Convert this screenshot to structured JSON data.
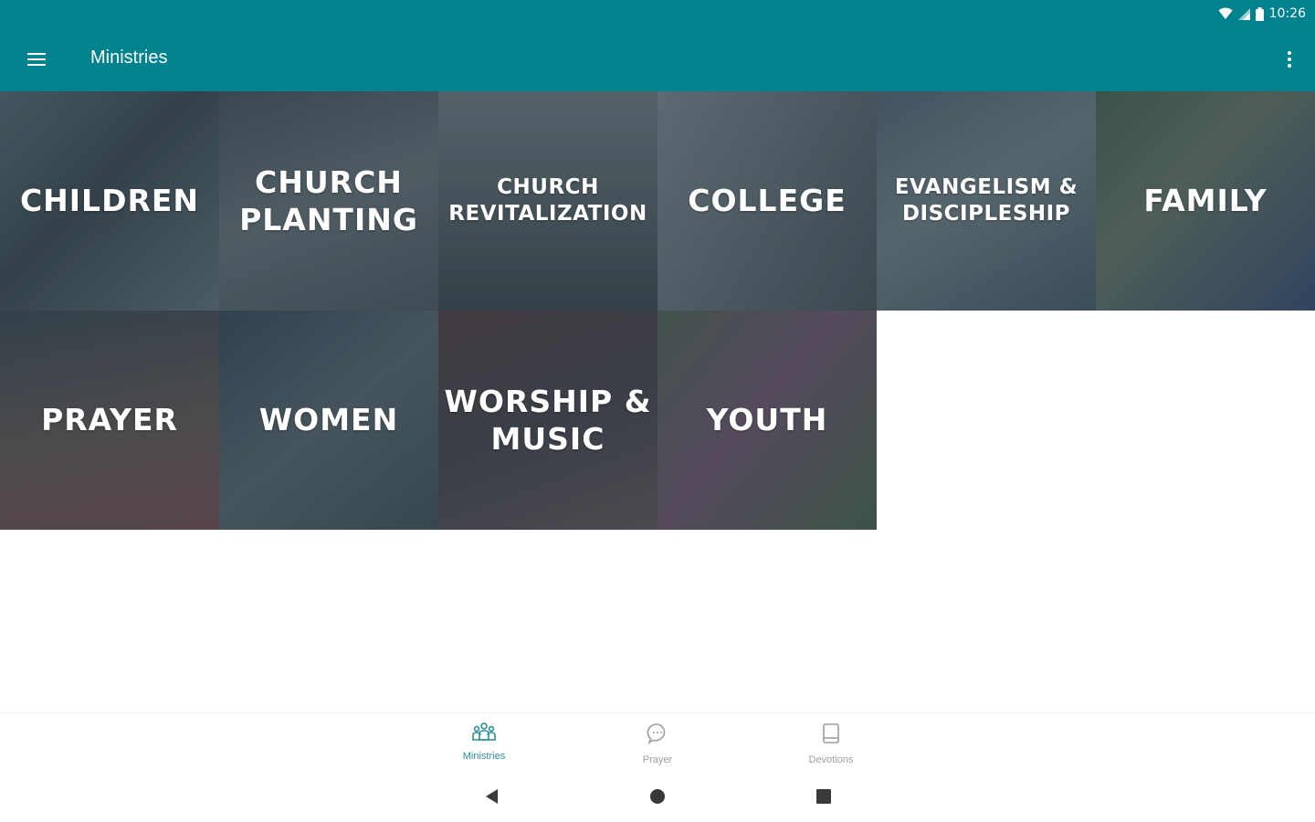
{
  "status_bar": {
    "time": "10:26"
  },
  "app_bar": {
    "title": "Ministries",
    "menu_icon": "hamburger-menu-icon",
    "overflow_icon": "more-vert-icon"
  },
  "tiles": [
    {
      "label": "CHILDREN",
      "size": "lg"
    },
    {
      "label": "CHURCH\nPLANTING",
      "size": "lg"
    },
    {
      "label": "CHURCH\nREVITALIZATION",
      "size": "sm"
    },
    {
      "label": "COLLEGE",
      "size": "lg"
    },
    {
      "label": "EVANGELISM &\nDISCIPLESHIP",
      "size": "sm"
    },
    {
      "label": "FAMILY",
      "size": "lg"
    },
    {
      "label": "PRAYER",
      "size": "lg"
    },
    {
      "label": "WOMEN",
      "size": "lg"
    },
    {
      "label": "WORSHIP &\nMUSIC",
      "size": "lg"
    },
    {
      "label": "YOUTH",
      "size": "lg"
    }
  ],
  "bottom_nav": {
    "items": [
      {
        "label": "Ministries",
        "icon": "people-group-icon",
        "active": true
      },
      {
        "label": "Prayer",
        "icon": "chat-bubble-icon",
        "active": false
      },
      {
        "label": "Devotions",
        "icon": "book-icon",
        "active": false
      }
    ]
  },
  "colors": {
    "primary": "#00838f",
    "active_nav": "#2a8f9e",
    "inactive_nav": "#9e9e9e"
  }
}
